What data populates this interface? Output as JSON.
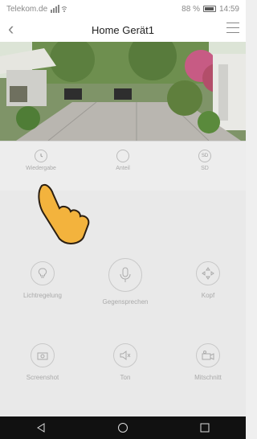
{
  "status_bar": {
    "carrier": "Telekom.de",
    "battery": "88 %",
    "time": "14:59"
  },
  "header": {
    "back_icon": "back-chevron-icon",
    "title": "Home Gerät1",
    "menu_icon": "hamburger-menu-icon"
  },
  "quick_bar": [
    {
      "label": "Wiedergabe",
      "icon": "playback-clock-icon"
    },
    {
      "label": "Anteil",
      "icon": "share-icon"
    },
    {
      "label": "SD",
      "icon": "sd-icon"
    }
  ],
  "controls": [
    {
      "label": "Lichtregelung",
      "icon": "light-bulb-icon"
    },
    {
      "label": "Gegensprechen",
      "icon": "microphone-icon"
    },
    {
      "label": "Kopf",
      "icon": "direction-pad-icon"
    },
    {
      "label": "Screenshot",
      "icon": "camera-icon"
    },
    {
      "label": "Ton",
      "icon": "speaker-muted-icon"
    },
    {
      "label": "Mitschnitt",
      "icon": "video-record-icon"
    }
  ],
  "system_nav": [
    {
      "icon": "back-triangle-icon"
    },
    {
      "icon": "home-circle-icon"
    },
    {
      "icon": "recents-square-icon"
    }
  ]
}
